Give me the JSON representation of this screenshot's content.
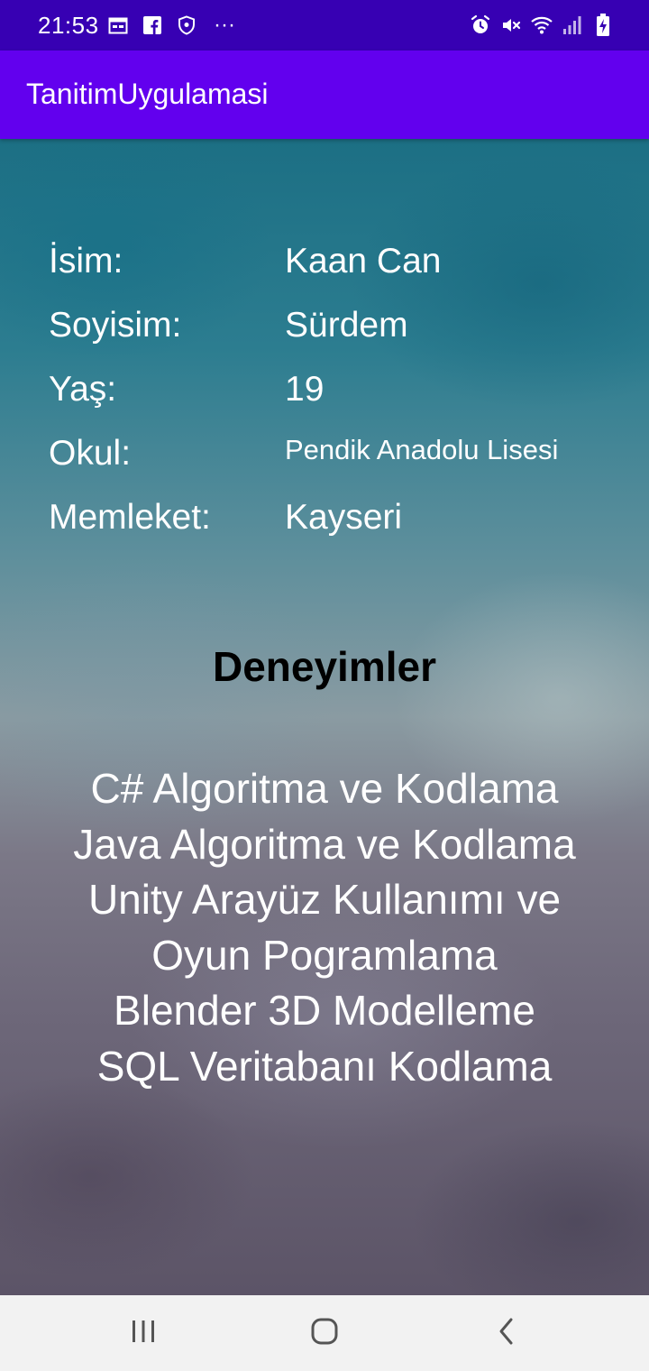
{
  "status_bar": {
    "time": "21:53",
    "left_icons": [
      "calendar-icon",
      "facebook-icon",
      "shield-icon",
      "more-dots-icon"
    ],
    "right_icons": [
      "alarm-icon",
      "mute-icon",
      "wifi-icon",
      "signal-icon",
      "battery-charging-icon"
    ],
    "more_glyph": "···"
  },
  "app_bar": {
    "title": "TanitimUygulamasi",
    "color": "#6200ee",
    "status_color": "#3700b3"
  },
  "profile": {
    "rows": [
      {
        "label": "İsim:",
        "value": "Kaan Can"
      },
      {
        "label": "Soyisim:",
        "value": "Sürdem"
      },
      {
        "label": "Yaş:",
        "value": "19"
      },
      {
        "label": "Okul:",
        "value": "Pendik Anadolu Lisesi"
      },
      {
        "label": "Memleket:",
        "value": "Kayseri"
      }
    ]
  },
  "experiences": {
    "title": "Deneyimler",
    "lines": [
      "C# Algoritma ve Kodlama",
      "Java Algoritma ve Kodlama",
      "Unity Arayüz Kullanımı ve",
      "Oyun Pogramlama",
      "Blender 3D Modelleme",
      "SQL Veritabanı Kodlama"
    ]
  },
  "nav_bar": {
    "buttons": [
      "recents-icon",
      "home-icon",
      "back-icon"
    ]
  }
}
